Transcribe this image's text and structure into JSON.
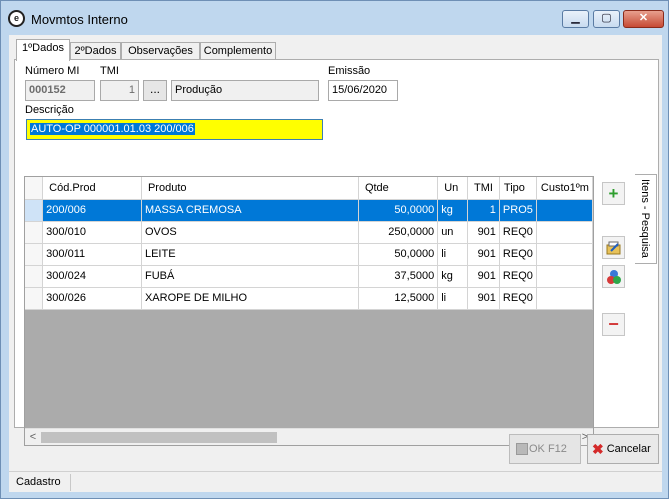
{
  "window": {
    "title": "Movmtos Interno",
    "icon": "cex-logo-icon",
    "min_glyph": "▁",
    "max_glyph": "▢",
    "close_glyph": "✕"
  },
  "tabs": [
    "1ºDados",
    "2ºDados",
    "Observações",
    "Complemento"
  ],
  "form": {
    "numero_mi_label": "Número MI",
    "numero_mi_value": "000152",
    "tmi_label": "TMI",
    "tmi_value": "1",
    "tmi_lookup_label": "...",
    "tmi_desc": "Produção",
    "emissao_label": "Emissão",
    "emissao_value": "15/06/2020",
    "descricao_label": "Descrição",
    "descricao_value": "AUTO-OP 000001.01.03  200/006"
  },
  "grid": {
    "columns": [
      "Cód.Prod",
      "Produto",
      "Qtde",
      "Un",
      "TMI",
      "Tipo",
      "Custo1ºm"
    ],
    "rows": [
      [
        "200/006",
        "MASSA CREMOSA",
        "50,0000",
        "kg",
        "1",
        "PRO5",
        ""
      ],
      [
        "300/010",
        "OVOS",
        "250,0000",
        "un",
        "901",
        "REQ0",
        ""
      ],
      [
        "300/011",
        "LEITE",
        "50,0000",
        "li",
        "901",
        "REQ0",
        ""
      ],
      [
        "300/024",
        "FUBÁ",
        "37,5000",
        "kg",
        "901",
        "REQ0",
        ""
      ],
      [
        "300/026",
        "XAROPE DE MILHO",
        "12,5000",
        "li",
        "901",
        "REQ0",
        ""
      ]
    ],
    "selected_row": 0,
    "scroll_left": "<",
    "scroll_right": ">"
  },
  "side_tab": "Itens - Pesquisa",
  "side_buttons": {
    "add": "+",
    "remove": "−"
  },
  "buttons": {
    "ok": "OK  F12",
    "cancel": "Cancelar"
  },
  "status": "Cadastro",
  "colors": {
    "selection": "#0078d7",
    "description_bg": "#ffff00",
    "add": "#2e9e2e",
    "remove": "#d23a3a"
  }
}
